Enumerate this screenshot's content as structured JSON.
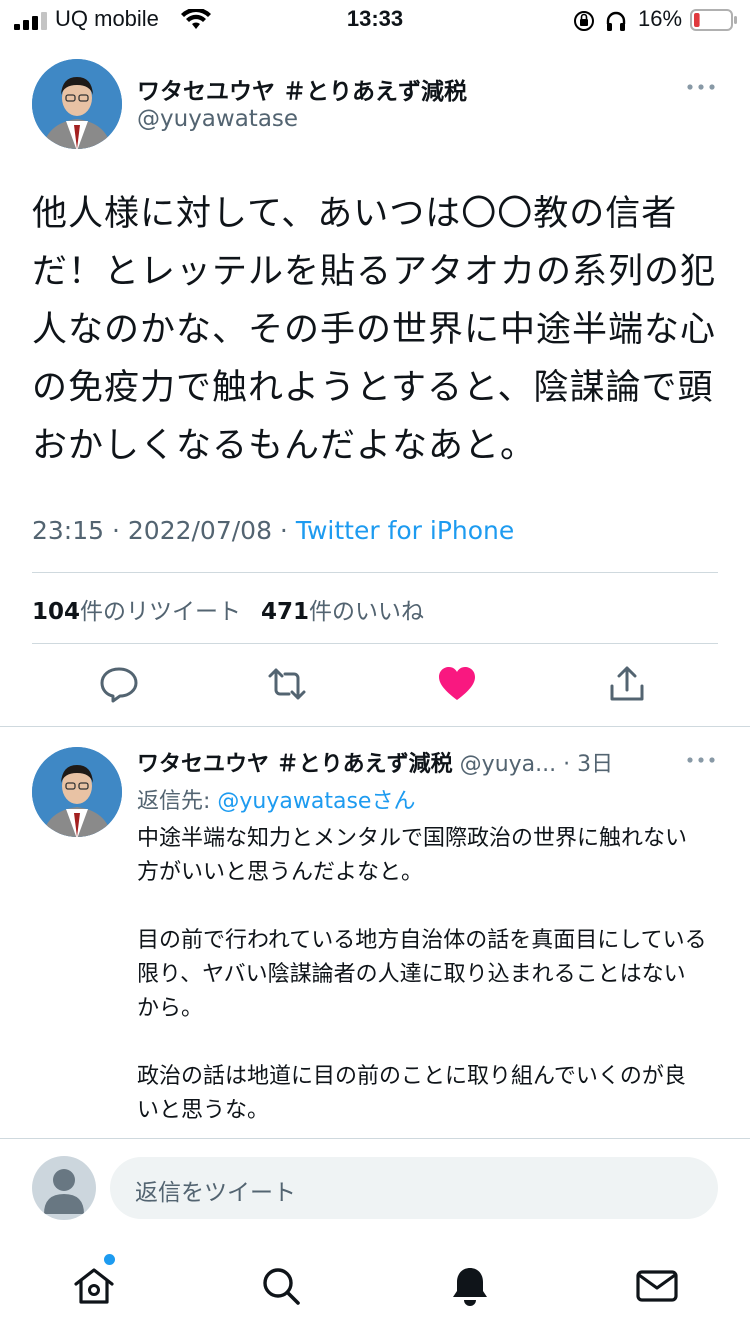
{
  "status_bar": {
    "carrier": "UQ mobile",
    "time": "13:33",
    "battery_percent": "16%",
    "battery_level": 0.16,
    "battery_color": "#e0393e"
  },
  "main_tweet": {
    "display_name": "ワタセユウヤ ＃とりあえず減税",
    "handle": "@yuyawatase",
    "text": "他人様に対して、あいつは〇〇教の信者だ！とレッテルを貼るアタオカの系列の犯人なのかな、その手の世界に中途半端な心の免疫力で触れようとすると、陰謀論で頭おかしくなるもんだよなあと。",
    "timestamp": "23:15 · 2022/07/08 · ",
    "source": "Twitter for iPhone",
    "retweet_count": "104",
    "retweet_label": "件のリツイート",
    "like_count": "471",
    "like_label": "件のいいね",
    "liked": true,
    "like_color": "#f91880"
  },
  "reply_tweet": {
    "display_name": "ワタセユウヤ ＃とりあえず減税",
    "handle": "@yuya...",
    "separator": " · ",
    "age": "3日",
    "reply_to_prefix": "返信先: ",
    "reply_to_user": "@yuyawataseさん",
    "paragraphs": [
      "中途半端な知力とメンタルで国際政治の世界に触れない方がいいと思うんだよなと。",
      "目の前で行われている地方自治体の話を真面目にしている限り、ヤバい陰謀論者の人達に取り込まれることはないから。",
      "政治の話は地道に目の前のことに取り組んでいくのが良いと思うな。"
    ]
  },
  "compose": {
    "placeholder": "返信をツイート"
  },
  "nav": {
    "items": [
      "home-icon",
      "search-icon",
      "notifications-icon",
      "messages-icon"
    ],
    "home_has_badge": true,
    "accent": "#1d9bf0"
  }
}
